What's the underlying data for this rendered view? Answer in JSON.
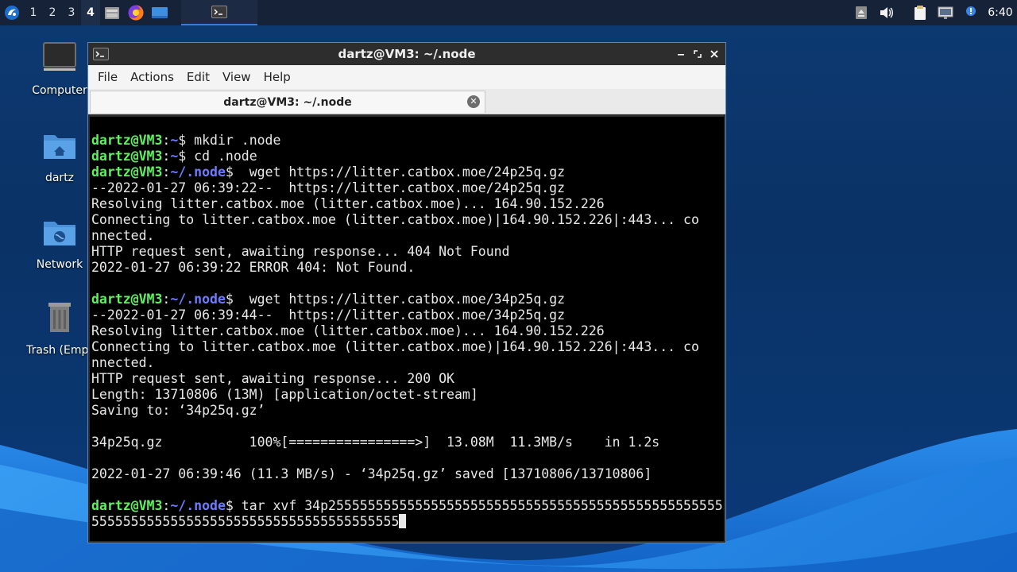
{
  "taskbar": {
    "workspaces": [
      "1",
      "2",
      "3",
      "4"
    ],
    "active_workspace": "4",
    "clock": "6:40"
  },
  "desktop": {
    "icons": [
      {
        "label": "Computer",
        "icon": "computer-icon"
      },
      {
        "label": "dartz",
        "icon": "home-folder-icon"
      },
      {
        "label": "Network",
        "icon": "network-folder-icon"
      },
      {
        "label": "Trash (Empt",
        "icon": "trash-icon"
      }
    ]
  },
  "window": {
    "title": "dartz@VM3: ~/.node",
    "menu": [
      "File",
      "Actions",
      "Edit",
      "View",
      "Help"
    ],
    "tab_label": "dartz@VM3: ~/.node"
  },
  "terminal": {
    "prompt_user": "dartz@VM3",
    "prompt_colon": ":",
    "lines": [
      {
        "type": "prompt",
        "path": "~",
        "sep": "$ ",
        "cmd": "mkdir .node"
      },
      {
        "type": "prompt",
        "path": "~",
        "sep": "$ ",
        "cmd": "cd .node"
      },
      {
        "type": "prompt",
        "path": "~/.node",
        "sep": "$  ",
        "cmd": "wget https://litter.catbox.moe/24p25q.gz"
      },
      {
        "type": "out",
        "text": "--2022-01-27 06:39:22--  https://litter.catbox.moe/24p25q.gz"
      },
      {
        "type": "out",
        "text": "Resolving litter.catbox.moe (litter.catbox.moe)... 164.90.152.226"
      },
      {
        "type": "out",
        "text": "Connecting to litter.catbox.moe (litter.catbox.moe)|164.90.152.226|:443... co"
      },
      {
        "type": "out",
        "text": "nnected."
      },
      {
        "type": "out",
        "text": "HTTP request sent, awaiting response... 404 Not Found"
      },
      {
        "type": "out",
        "text": "2022-01-27 06:39:22 ERROR 404: Not Found."
      },
      {
        "type": "out",
        "text": ""
      },
      {
        "type": "prompt",
        "path": "~/.node",
        "sep": "$  ",
        "cmd": "wget https://litter.catbox.moe/34p25q.gz"
      },
      {
        "type": "out",
        "text": "--2022-01-27 06:39:44--  https://litter.catbox.moe/34p25q.gz"
      },
      {
        "type": "out",
        "text": "Resolving litter.catbox.moe (litter.catbox.moe)... 164.90.152.226"
      },
      {
        "type": "out",
        "text": "Connecting to litter.catbox.moe (litter.catbox.moe)|164.90.152.226|:443... co"
      },
      {
        "type": "out",
        "text": "nnected."
      },
      {
        "type": "out",
        "text": "HTTP request sent, awaiting response... 200 OK"
      },
      {
        "type": "out",
        "text": "Length: 13710806 (13M) [application/octet-stream]"
      },
      {
        "type": "out",
        "text": "Saving to: ‘34p25q.gz’"
      },
      {
        "type": "out",
        "text": ""
      },
      {
        "type": "out",
        "text": "34p25q.gz           100%[================>]  13.08M  11.3MB/s    in 1.2s"
      },
      {
        "type": "out",
        "text": ""
      },
      {
        "type": "out",
        "text": "2022-01-27 06:39:46 (11.3 MB/s) - ‘34p25q.gz’ saved [13710806/13710806]"
      },
      {
        "type": "out",
        "text": ""
      },
      {
        "type": "prompt",
        "path": "~/.node",
        "sep": "$ ",
        "cmd": "tar xvf 34p255555555555555555555555555555555555555555555555555"
      },
      {
        "type": "out",
        "text": "555555555555555555555555555555555555555",
        "cursor": true
      }
    ]
  }
}
